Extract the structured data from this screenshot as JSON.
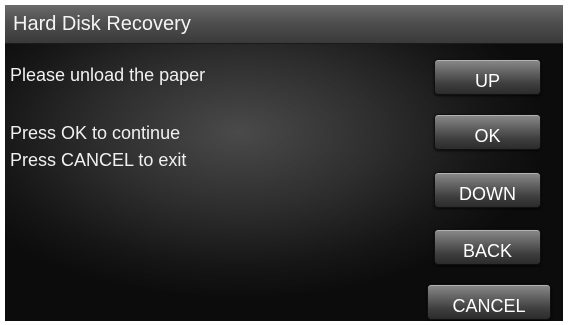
{
  "title": "Hard Disk Recovery",
  "messages": {
    "line1": "Please unload the paper",
    "line2": "Press OK to continue",
    "line3": "Press CANCEL to exit"
  },
  "buttons": {
    "up": "UP",
    "ok": "OK",
    "down": "DOWN",
    "back": "BACK",
    "cancel": "CANCEL"
  }
}
